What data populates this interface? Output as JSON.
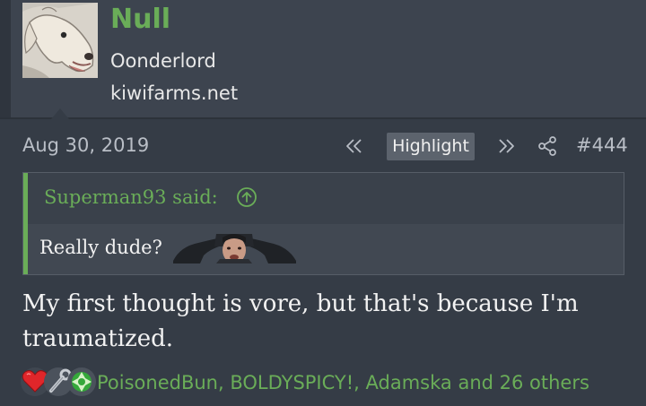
{
  "user": {
    "name": "Null",
    "title": "Oonderlord",
    "site": "kiwifarms.net"
  },
  "post": {
    "date": "Aug 30, 2019",
    "highlight_label": "Highlight",
    "number": "#444"
  },
  "quote": {
    "author": "Superman93 said:",
    "text": "Really dude?"
  },
  "message": {
    "lines": [
      "My first thought is vore, but that's because I'm",
      "traumatized."
    ]
  },
  "reactions": {
    "text": "PoisonedBun, BOLDYSPICY!, Adamska and 26 others",
    "icons": [
      "heart-icon",
      "wrench-icon",
      "spin-icon"
    ]
  },
  "colors": {
    "accent": "#6aad58",
    "background": "#353c46",
    "header": "#3d444f"
  }
}
